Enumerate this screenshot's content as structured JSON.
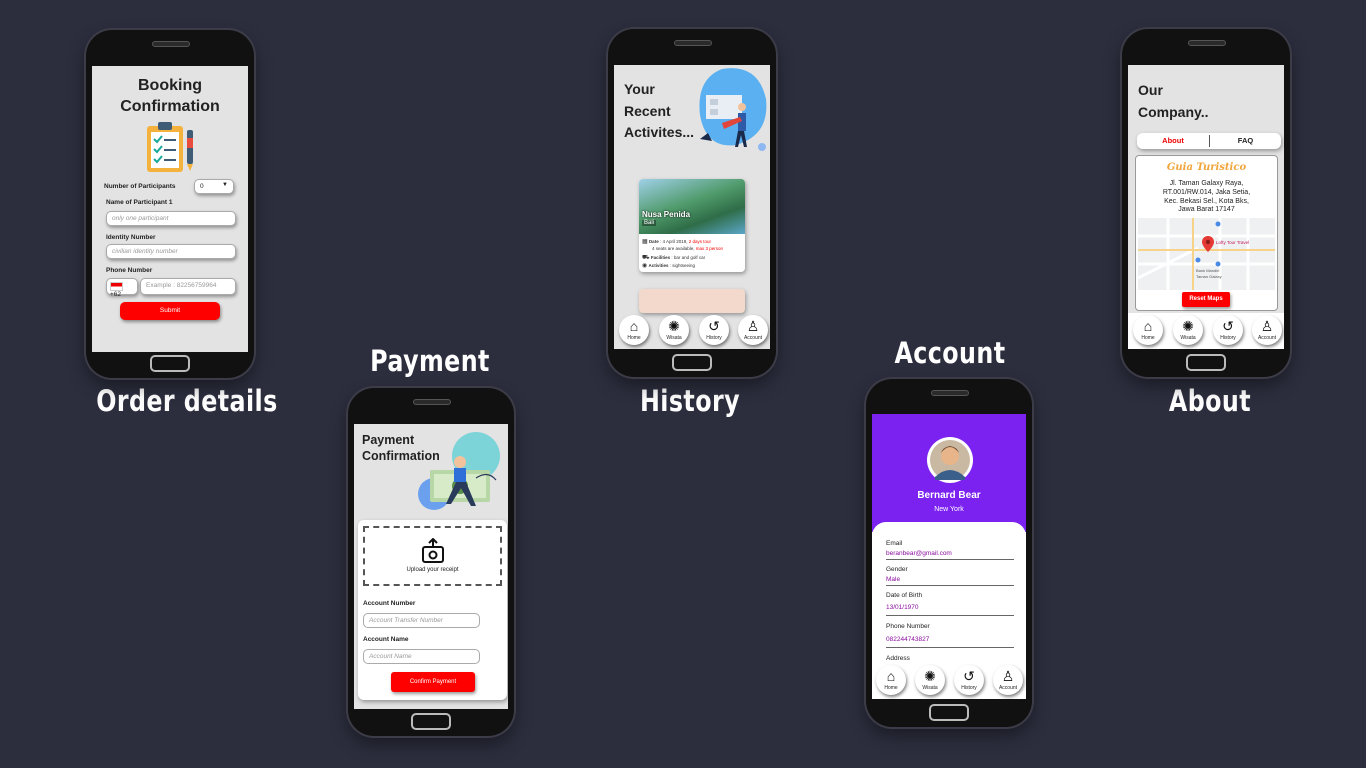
{
  "captions": {
    "order": "Order details",
    "payment": "Payment",
    "history": "History",
    "account": "Account",
    "about": "About"
  },
  "booking": {
    "title_line1": "Booking",
    "title_line2": "Confirmation",
    "participants_label": "Number of Participants",
    "participants_value": "0",
    "name_label": "Name of Participant 1",
    "name_placeholder": "only one participant",
    "identity_label": "Identity Number",
    "identity_placeholder": "civilian identity number",
    "phone_label": "Phone Number",
    "phone_code": "+62",
    "phone_placeholder": "Example : 82256759964",
    "submit": "Submit"
  },
  "payment": {
    "title_line1": "Payment",
    "title_line2": "Confirmation",
    "upload_label": "Upload your receipt",
    "account_number_label": "Account Number",
    "account_number_placeholder": "Account Transfer Number",
    "account_name_label": "Account Name",
    "account_name_placeholder": "Account Name",
    "confirm": "Confirm Payment"
  },
  "history": {
    "title_line1": "Your",
    "title_line2": "Recent",
    "title_line3": "Activites...",
    "card": {
      "place": "Nusa Penida",
      "region": "Bali",
      "date_label": "Date",
      "date_value": ": 4 April 2019,",
      "date_extra": "2 days tour",
      "seats": "4 seats are available,",
      "seats_extra": "max 3 person",
      "facilities_label": "Facilities",
      "facilities_value": ": bar and golf car",
      "activities_label": "Activities",
      "activities_value": ": sightseeing"
    }
  },
  "about": {
    "title_line1": "Our",
    "title_line2": "Company..",
    "tab_about": "About",
    "tab_faq": "FAQ",
    "brand": "Guia Turistico",
    "address": [
      "Jl. Taman Galaxy Raya,",
      "RT.001/RW.014, Jaka Setia,",
      "Kec. Bekasi Sel., Kota Bks,",
      "Jawa Barat 17147"
    ],
    "map_pin_label": "Lofty Tour Travel",
    "map_bank": "Bank Mandiri",
    "map_bank_sub": "Taman Galaxy",
    "reset": "Reset Maps"
  },
  "account": {
    "name": "Bernard Bear",
    "city": "New York",
    "fields": [
      {
        "label": "Email",
        "value": "beranbear@gmail.com"
      },
      {
        "label": "Gender",
        "value": "Male"
      },
      {
        "label": "Date of Birth",
        "value": "13/01/1970"
      },
      {
        "label": "Phone Number",
        "value": "082244743827"
      }
    ],
    "address_label": "Address"
  },
  "nav": {
    "home": "Home",
    "wisata": "Wisata",
    "history": "History",
    "account": "Account"
  },
  "colors": {
    "background": "#2c2e3e",
    "accent_red": "#ff0000",
    "account_purple": "#7b22f0",
    "value_purple": "#8a0d9e"
  }
}
